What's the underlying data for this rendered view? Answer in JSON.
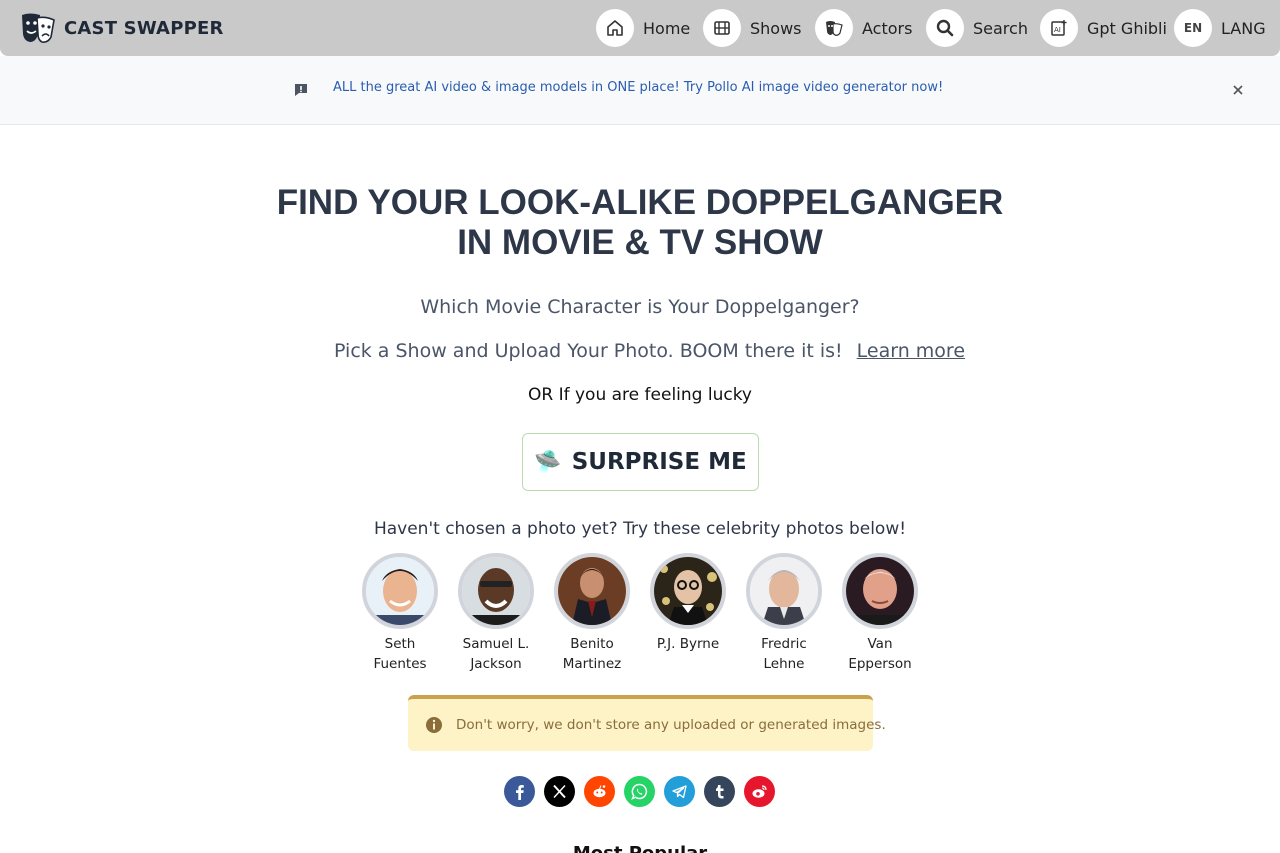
{
  "header": {
    "brand": "CAST SWAPPER",
    "nav": [
      {
        "label": "Home",
        "icon": "home-icon"
      },
      {
        "label": "Shows",
        "icon": "film-icon"
      },
      {
        "label": "Actors",
        "icon": "masks-icon"
      },
      {
        "label": "Search",
        "icon": "search-icon"
      },
      {
        "label": "Gpt Ghibli",
        "icon": "ai-image-icon"
      },
      {
        "label": "LANG",
        "badge": "EN"
      }
    ]
  },
  "banner": {
    "text": "ALL the great AI video & image models in ONE place! Try Pollo AI image video generator now!"
  },
  "hero": {
    "title_line1": "FIND YOUR LOOK-ALIKE DOPPELGANGER",
    "title_line2": "IN MOVIE & TV SHOW",
    "subtitle": "Which Movie Character is Your Doppelganger?",
    "pick_text": "Pick a Show and Upload Your Photo. BOOM there it is!",
    "learn_more": "Learn more",
    "lucky": "OR If you are feeling lucky",
    "surprise_button": "SURPRISE ME",
    "surprise_icon": "🛸"
  },
  "celebrities": {
    "prompt": "Haven't chosen a photo yet? Try these celebrity photos below!",
    "items": [
      {
        "name_line1": "Seth",
        "name_line2": "Fuentes"
      },
      {
        "name_line1": "Samuel L.",
        "name_line2": "Jackson"
      },
      {
        "name_line1": "Benito",
        "name_line2": "Martinez"
      },
      {
        "name_line1": "P.J. Byrne",
        "name_line2": ""
      },
      {
        "name_line1": "Fredric",
        "name_line2": "Lehne"
      },
      {
        "name_line1": "Van",
        "name_line2": "Epperson"
      }
    ]
  },
  "notice": {
    "text": "Don't worry, we don't store any uploaded or generated images."
  },
  "share": {
    "networks": [
      "facebook",
      "x",
      "reddit",
      "whatsapp",
      "telegram",
      "tumblr",
      "weibo"
    ],
    "colors": {
      "facebook": "#3b5998",
      "x": "#000000",
      "reddit": "#ff4500",
      "whatsapp": "#25d366",
      "telegram": "#229ed9",
      "tumblr": "#35465c",
      "weibo": "#e6162d"
    }
  },
  "footer_peek": {
    "heading": "Most Popular"
  }
}
